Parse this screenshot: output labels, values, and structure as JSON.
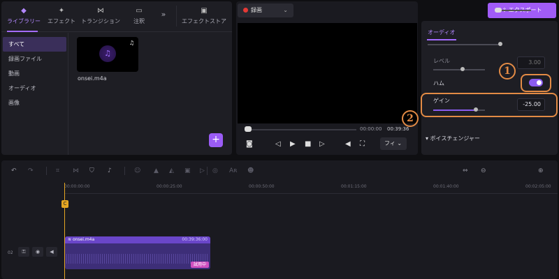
{
  "library": {
    "tabs": [
      {
        "label": "ライブラリー",
        "icon": "layers-icon"
      },
      {
        "label": "エフェクト",
        "icon": "sparkle-icon"
      },
      {
        "label": "トランジション",
        "icon": "transition-icon"
      },
      {
        "label": "注釈",
        "icon": "comment-icon"
      },
      {
        "label": "エフェクトストア",
        "icon": "store-icon"
      }
    ],
    "more": "»",
    "sidebar": [
      "すべて",
      "録画ファイル",
      "動画",
      "オーディオ",
      "画像"
    ],
    "media": {
      "name": "onsei.m4a"
    },
    "add": "+"
  },
  "preview": {
    "mode": "録画",
    "time_current": "00:00:00",
    "time_total": "00:39:36",
    "fit": "フィ"
  },
  "export": {
    "label": "エクスポート",
    "icon": "upload-icon"
  },
  "props": {
    "tab": "オーディオ",
    "level_label": "レベル",
    "level_value": "3.00",
    "hum_label": "ハム",
    "gain_label": "ゲイン",
    "gain_value": "-25.00",
    "voice_changer": "ボイスチェンジャー",
    "annotations": [
      "1",
      "2"
    ],
    "annotation_color": "#e38b45",
    "hum_enabled": true
  },
  "timeline": {
    "ruler": [
      "00:00:00:00",
      "00:00:25:00",
      "00:00:50:00",
      "00:01:15:00",
      "00:01:40:00",
      "00:02:05:00"
    ],
    "track_number": "02",
    "clip": {
      "name": "onsei.m4a",
      "duration": "00:39:36:00",
      "badge": "試用中"
    },
    "playhead_label": "C"
  },
  "colors": {
    "accent": "#a15cf7",
    "playhead": "#e5a623"
  }
}
